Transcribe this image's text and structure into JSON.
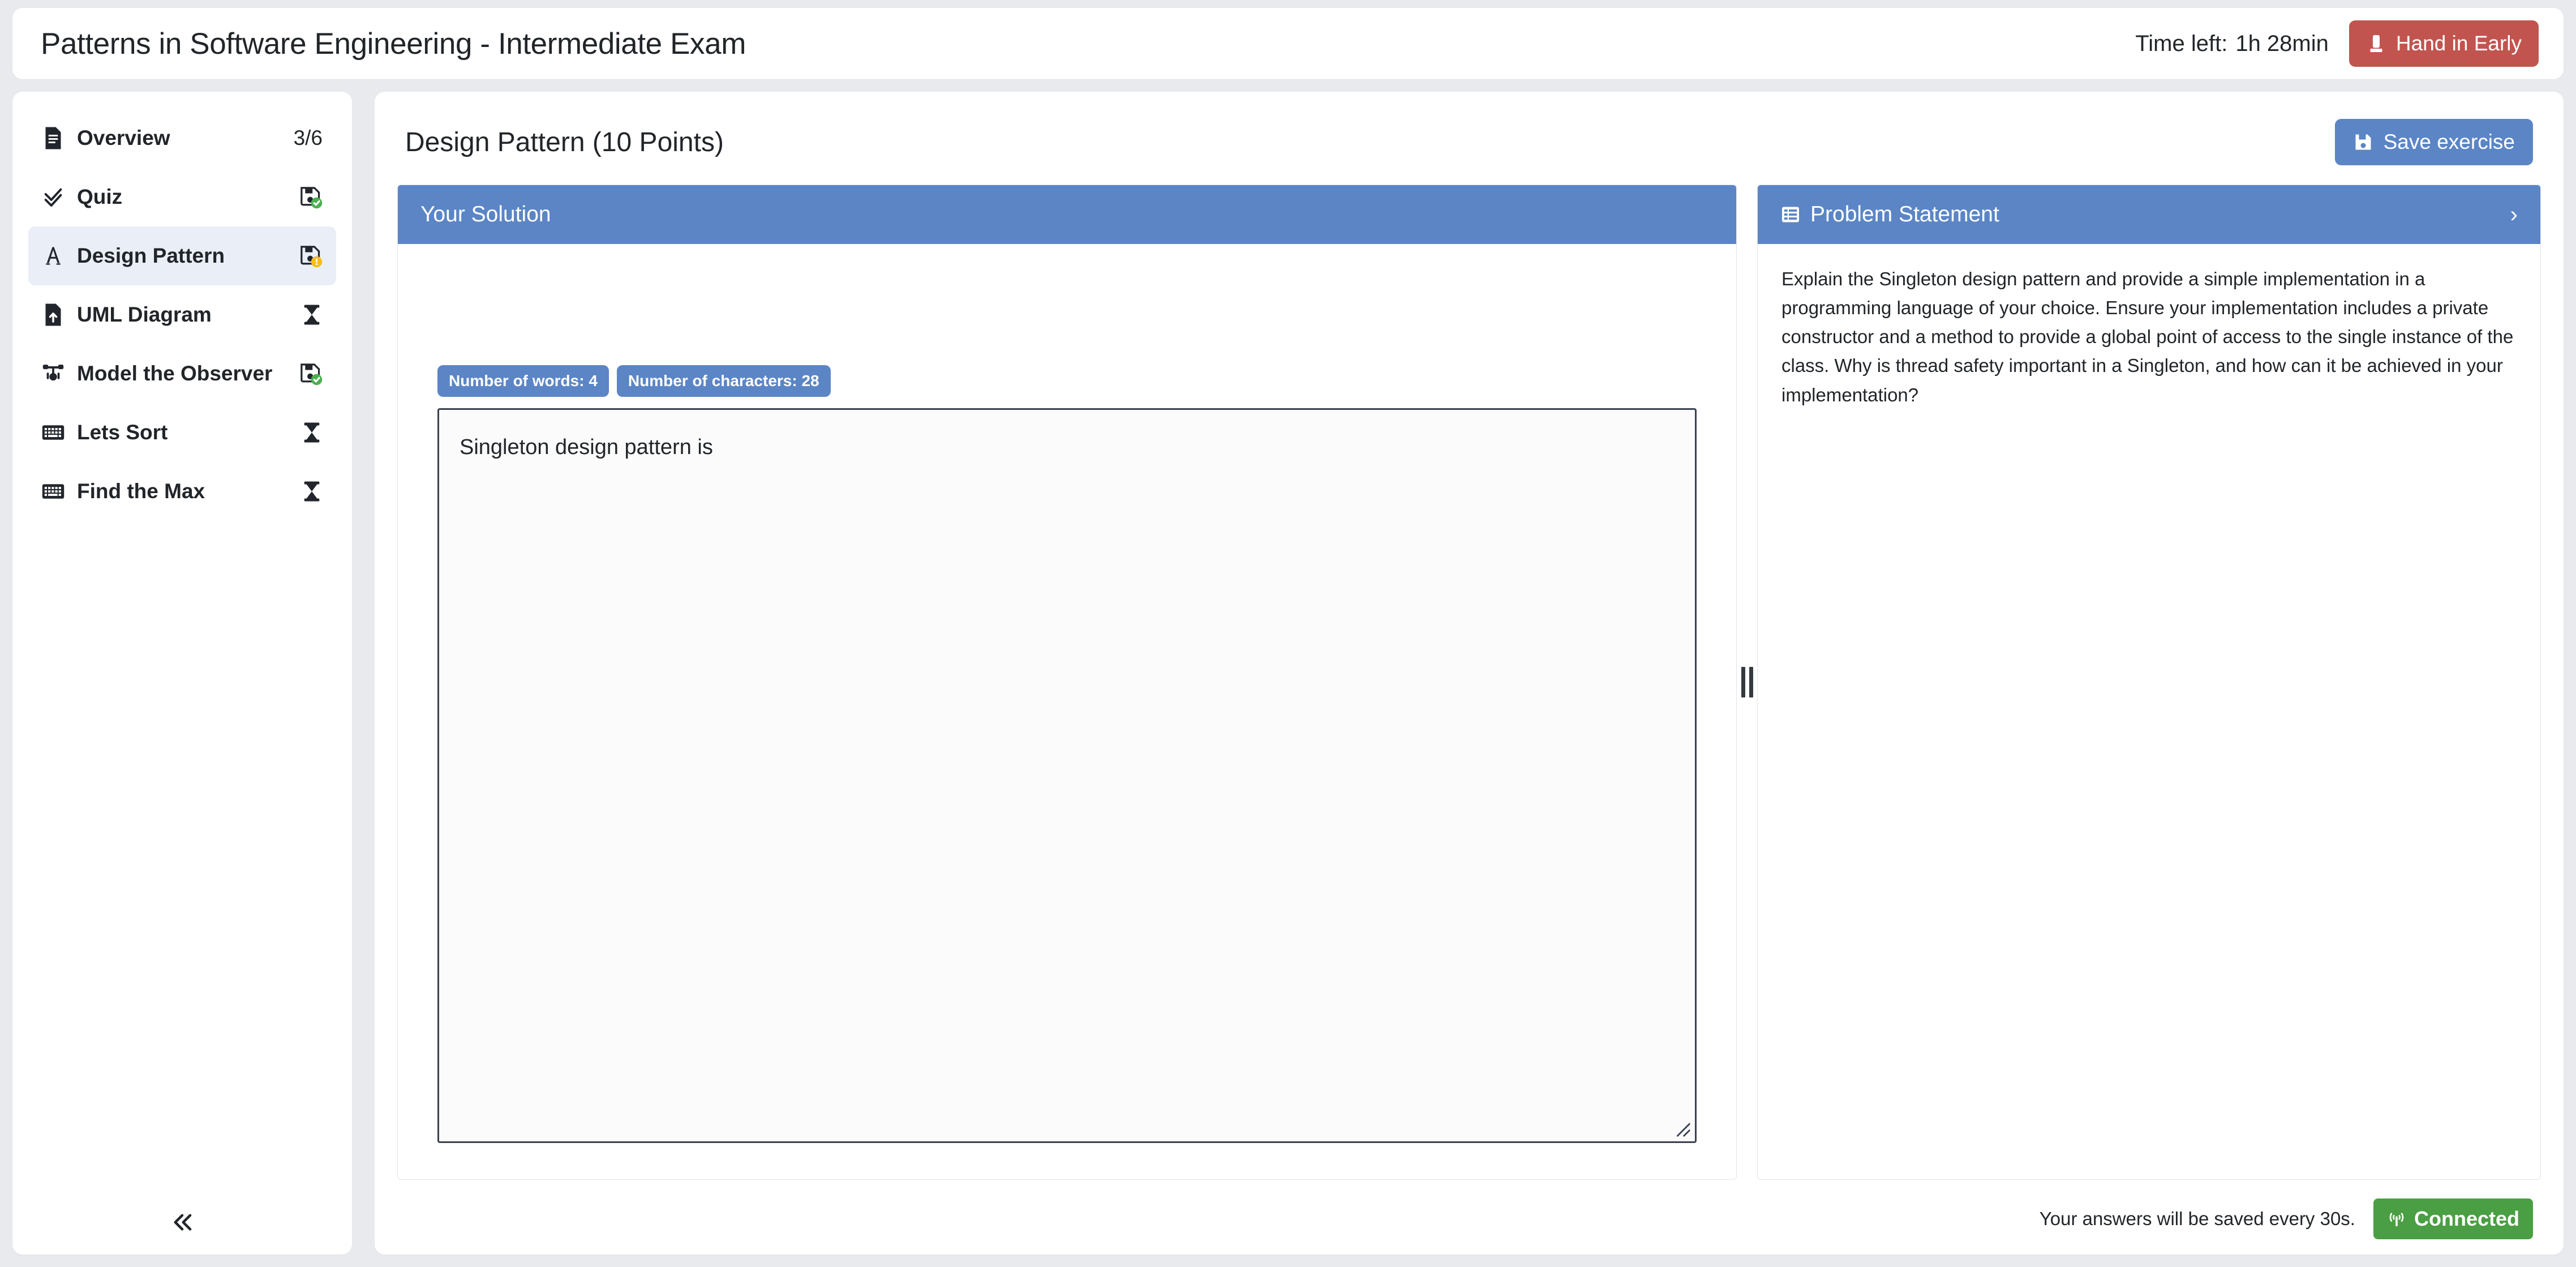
{
  "header": {
    "exam_title": "Patterns in Software Engineering - Intermediate Exam",
    "time_left_label": "Time left:",
    "time_left_value": "1h 28min",
    "hand_in_label": "Hand in Early",
    "hand_in_color": "#c2544f"
  },
  "sidebar": {
    "collapse_label": "«",
    "items": [
      {
        "label": "Overview",
        "icon": "document-icon",
        "status": "count",
        "count": "3/6"
      },
      {
        "label": "Quiz",
        "icon": "double-check-icon",
        "status": "saved-ok",
        "count": ""
      },
      {
        "label": "Design Pattern",
        "icon": "text-a-icon",
        "status": "saved-warning",
        "count": "",
        "active": true
      },
      {
        "label": "UML Diagram",
        "icon": "file-upload-icon",
        "status": "pending",
        "count": ""
      },
      {
        "label": "Model the Observer",
        "icon": "graph-node-icon",
        "status": "saved-ok",
        "count": ""
      },
      {
        "label": "Lets Sort",
        "icon": "keyboard-icon",
        "status": "pending",
        "count": ""
      },
      {
        "label": "Find the Max",
        "icon": "keyboard-icon",
        "status": "pending",
        "count": ""
      }
    ]
  },
  "main": {
    "exercise_title": "Design Pattern (10 Points)",
    "save_exercise_label": "Save exercise",
    "accent_blue": "#5b85c5",
    "solution": {
      "panel_title": "Your Solution",
      "word_badge": "Number of words: 4",
      "char_badge": "Number of characters: 28",
      "answer_text": "Singleton design pattern is",
      "answer_placeholder": ""
    },
    "problem": {
      "panel_title": "Problem Statement",
      "collapse_icon": "›",
      "text": "Explain the Singleton design pattern and provide a simple implementation in a programming language of your choice. Ensure your implementation includes a private constructor and a method to provide a global point of access to the single instance of the class. Why is thread safety important in a Singleton, and how can it be achieved in your implementation?"
    },
    "footer": {
      "autosave_note": "Your answers will be saved every 30s.",
      "connection_label": "Connected",
      "connection_color": "#4a9e43"
    }
  }
}
